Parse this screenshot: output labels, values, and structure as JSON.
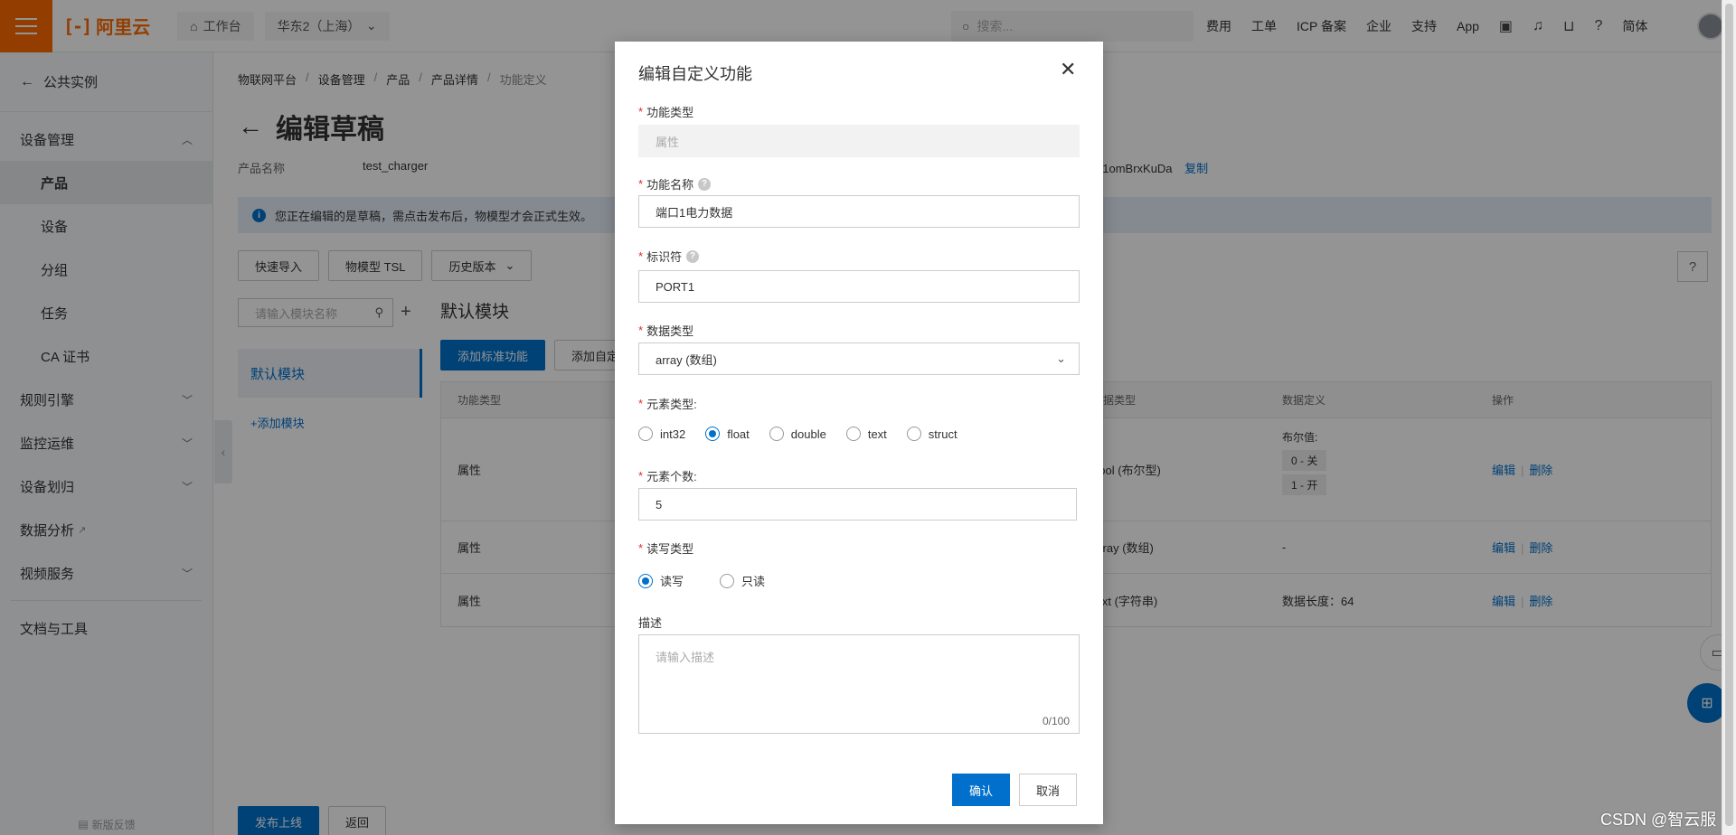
{
  "topbar": {
    "logo_text": "阿里云",
    "workbench": "工作台",
    "region": "华东2（上海）",
    "search_placeholder": "搜索...",
    "links": [
      "费用",
      "工单",
      "ICP 备案",
      "企业",
      "支持",
      "App"
    ],
    "language": "简体"
  },
  "sidebar": {
    "back_label": "公共实例",
    "groups": [
      {
        "label": "设备管理",
        "expanded": true
      },
      {
        "label": "规则引擎"
      },
      {
        "label": "监控运维"
      },
      {
        "label": "设备划归"
      },
      {
        "label": "数据分析"
      },
      {
        "label": "视频服务"
      },
      {
        "label": "文档与工具"
      }
    ],
    "items": [
      {
        "label": "产品",
        "active": true
      },
      {
        "label": "设备"
      },
      {
        "label": "分组"
      },
      {
        "label": "任务"
      },
      {
        "label": "CA 证书"
      }
    ],
    "feedback": "新版反馈"
  },
  "main": {
    "breadcrumb": [
      "物联网平台",
      "设备管理",
      "产品",
      "产品详情",
      "功能定义"
    ],
    "title": "编辑草稿",
    "product_name_label": "产品名称",
    "product_name_value": "test_charger",
    "product_key_partial": "a1omBrxKuDa",
    "copy_label": "复制",
    "notice": "您正在编辑的是草稿，需点击发布后，物模型才会正式生效。",
    "toolbar": [
      "快速导入",
      "物模型 TSL",
      "历史版本"
    ],
    "module_search_placeholder": "请输入模块名称",
    "module_default": "默认模块",
    "add_module": "+添加模块",
    "section_title": "默认模块",
    "add_standard": "添加标准功能",
    "add_custom": "添加自定义功能",
    "table": {
      "headers": [
        "功能类型",
        "数据类型",
        "数据定义",
        "操作"
      ],
      "rows": [
        {
          "type": "属性",
          "dtype": "bool (布尔型)",
          "def_title": "布尔值:",
          "def_tags": [
            "0 - 关",
            "1 - 开"
          ],
          "def_text": ""
        },
        {
          "type": "属性",
          "dtype": "array (数组)",
          "def_title": "",
          "def_tags": [],
          "def_text": "-"
        },
        {
          "type": "属性",
          "dtype": "text (字符串)",
          "def_title": "",
          "def_tags": [],
          "def_text": "数据长度：64"
        }
      ],
      "edit_label": "编辑",
      "delete_label": "删除"
    },
    "publish": "发布上线",
    "back": "返回"
  },
  "modal": {
    "title": "编辑自定义功能",
    "func_type_label": "功能类型",
    "func_type_value": "属性",
    "func_name_label": "功能名称",
    "func_name_value": "端口1电力数据",
    "identifier_label": "标识符",
    "identifier_value": "PORT1",
    "data_type_label": "数据类型",
    "data_type_value": "array (数组)",
    "element_type_label": "元素类型:",
    "element_types": [
      "int32",
      "float",
      "double",
      "text",
      "struct"
    ],
    "element_type_selected": "float",
    "element_count_label": "元素个数:",
    "element_count_value": "5",
    "rw_label": "读写类型",
    "rw_options": [
      "读写",
      "只读"
    ],
    "rw_selected": "读写",
    "desc_label": "描述",
    "desc_placeholder": "请输入描述",
    "desc_counter": "0/100",
    "confirm": "确认",
    "cancel": "取消"
  },
  "watermark": "CSDN @智云服",
  "colors": {
    "brand": "#ff6a00",
    "primary": "#0070cc",
    "required": "#d93026"
  }
}
